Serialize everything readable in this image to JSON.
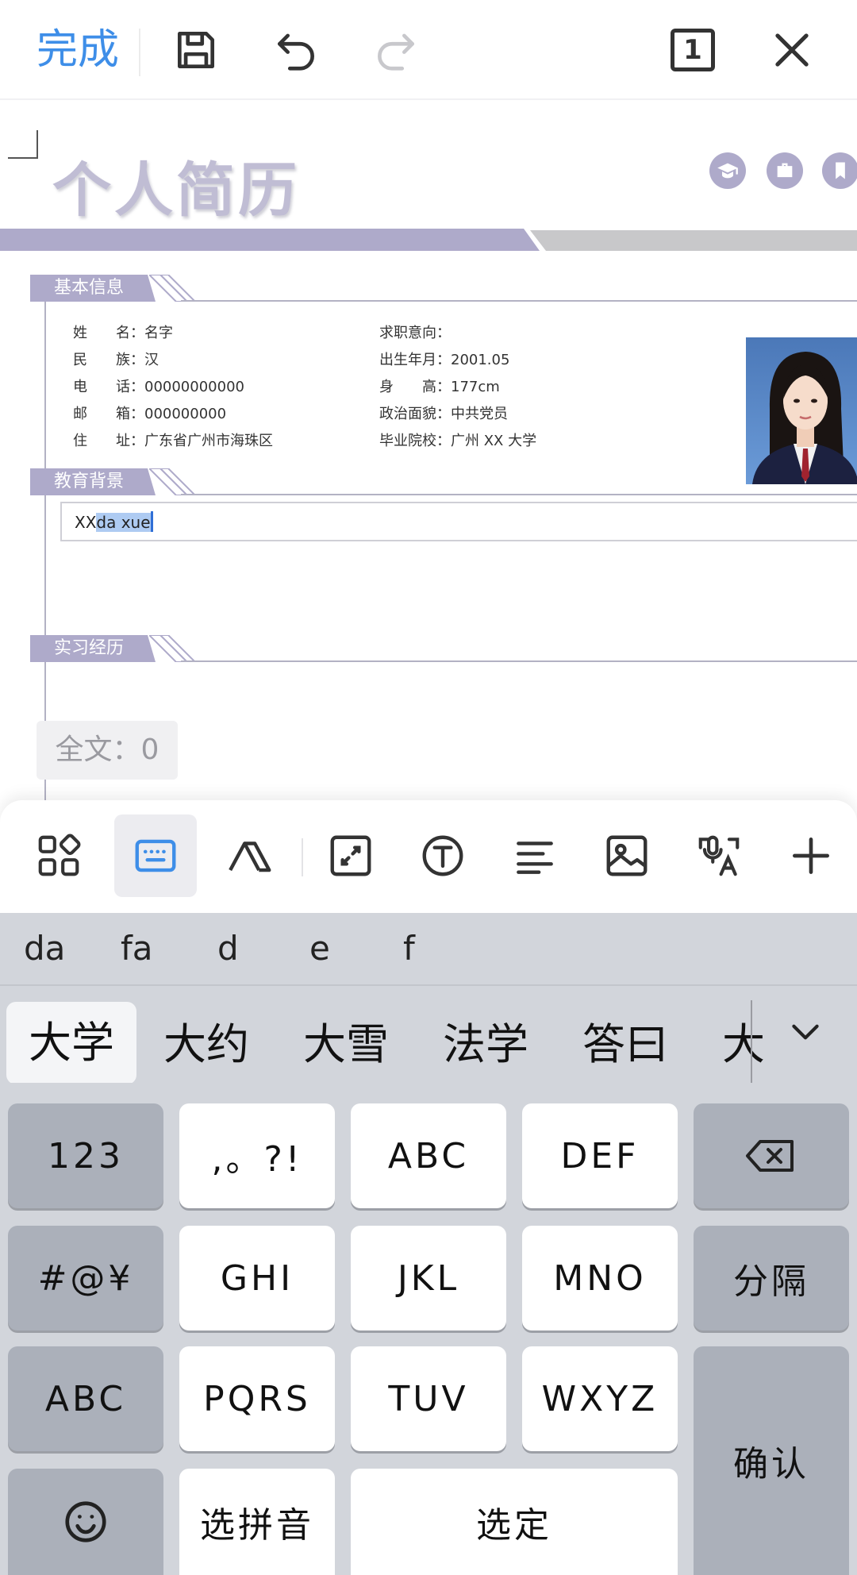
{
  "toolbar": {
    "done_label": "完成",
    "page_count": "1",
    "icons": [
      "save-icon",
      "undo-icon",
      "redo-icon",
      "page-count-icon",
      "close-icon"
    ]
  },
  "document": {
    "title": "个人简历",
    "title_icons": [
      "graduation-cap-icon",
      "briefcase-icon",
      "bookmark-icon"
    ],
    "sections": {
      "basic": "基本信息",
      "education": "教育背景",
      "internship": "实习经历"
    },
    "basic_info": {
      "left": [
        {
          "key": "姓　　名：",
          "value": "名字"
        },
        {
          "key": "民　　族：",
          "value": "汉"
        },
        {
          "key": "电　　话：",
          "value": "00000000000"
        },
        {
          "key": "邮　　箱：",
          "value": "000000000"
        },
        {
          "key": "住　　址：",
          "value": "广东省广州市海珠区"
        }
      ],
      "right": [
        {
          "key": "求职意向：",
          "value": ""
        },
        {
          "key": "出生年月：",
          "value": "2001.05"
        },
        {
          "key": "身　　高：",
          "value": "177cm"
        },
        {
          "key": "政治面貌：",
          "value": "中共党员"
        },
        {
          "key": "毕业院校：",
          "value": "广州 XX 大学"
        }
      ]
    },
    "education_input": {
      "prefix": "XX",
      "composing": "da xue"
    },
    "word_count": "全文：0"
  },
  "tools": [
    "grid-icon",
    "keyboard-icon",
    "text-style-icon",
    "fullscreen-icon",
    "text-circle-icon",
    "align-icon",
    "image-icon",
    "voice-translate-icon",
    "plus-icon"
  ],
  "keyboard": {
    "pinyin_options": [
      "da",
      "fa",
      "d",
      "e",
      "f"
    ],
    "candidates": [
      "大学",
      "大约",
      "大雪",
      "法学",
      "答曰",
      "大"
    ],
    "keys": {
      "row1": [
        "123",
        ",。?!",
        "ABC",
        "DEF"
      ],
      "row2": [
        "#@¥",
        "GHI",
        "JKL",
        "MNO",
        "分隔"
      ],
      "row3": [
        "ABC",
        "PQRS",
        "TUV",
        "WXYZ"
      ],
      "row4": [
        "选拼音",
        "选定"
      ],
      "confirm": "确认"
    }
  },
  "colors": {
    "accent": "#3e8ee8",
    "resume_purple": "#aeaaca",
    "keyboard_bg": "#d2d5db"
  }
}
